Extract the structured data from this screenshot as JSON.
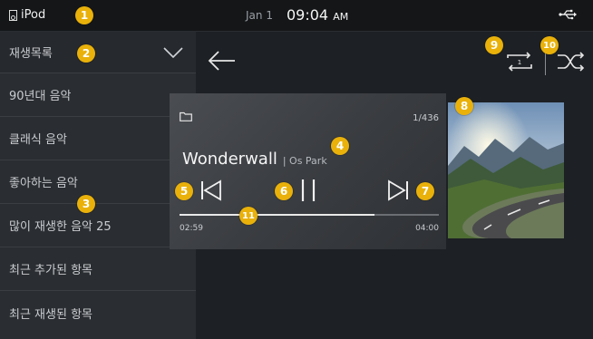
{
  "status": {
    "source": "iPod",
    "date": "Jan 1",
    "time": "09:04",
    "ampm": "AM"
  },
  "sidebar": {
    "header_label": "재생목록",
    "items": [
      {
        "label": "90년대 음악"
      },
      {
        "label": "클래식 음악"
      },
      {
        "label": "좋아하는 음악"
      },
      {
        "label": "많이 재생한 음악 25"
      },
      {
        "label": "최근 추가된 항목"
      },
      {
        "label": "최근 재생된 항목"
      }
    ]
  },
  "player": {
    "track_counter": "1/436",
    "title": "Wonderwall",
    "artist": "Os Park",
    "elapsed": "02:59",
    "total": "04:00",
    "progress_fraction": 0.75
  },
  "callouts": [
    "1",
    "2",
    "3",
    "4",
    "5",
    "6",
    "7",
    "8",
    "9",
    "10",
    "11"
  ],
  "icons": {
    "repeat_badge": "1"
  },
  "colors": {
    "callout": "#e9b10a",
    "background": "#1d2024",
    "sidebar": "#2a2d31"
  }
}
